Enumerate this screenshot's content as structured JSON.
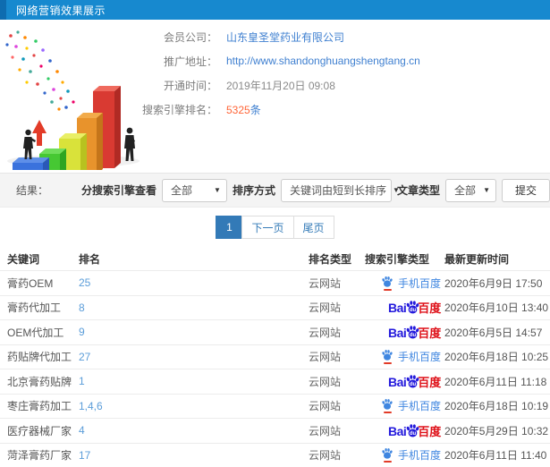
{
  "header": {
    "title": "网络营销效果展示"
  },
  "info": {
    "fields": [
      {
        "label": "会员公司：",
        "value": "山东皇圣堂药业有限公司"
      },
      {
        "label": "推广地址：",
        "value": "http://www.shandonghuangshengtang.cn"
      },
      {
        "label": "开通时间：",
        "value": "2019年11月20日 09:08"
      },
      {
        "label": "搜索引擎排名：",
        "value": "5325",
        "unit": "条"
      }
    ]
  },
  "filters": {
    "result_label": "结果：",
    "engine_filter_label": "分搜索引擎查看",
    "engine_filter_value": "全部",
    "sort_label": "排序方式",
    "sort_value": "关键词由短到长排序",
    "article_type_label": "文章类型",
    "article_type_value": "全部",
    "submit_label": "提交"
  },
  "pagination": {
    "current": "1",
    "next_label": "下一页",
    "last_label": "尾页"
  },
  "table": {
    "columns": [
      "关键词",
      "排名",
      "排名类型",
      "搜索引擎类型",
      "最新更新时间"
    ],
    "engine_labels": {
      "mobile": "手机百度",
      "baidu_bai": "Bai",
      "baidu_du": "du",
      "baidu_cn": "百度"
    },
    "rows": [
      {
        "keyword": "膏药OEM",
        "rank": "25",
        "rank_type": "云网站",
        "engine": "mobile-baidu",
        "updated": "2020年6月9日 17:50"
      },
      {
        "keyword": "膏药代加工",
        "rank": "8",
        "rank_type": "云网站",
        "engine": "baidu",
        "updated": "2020年6月10日 13:40"
      },
      {
        "keyword": "OEM代加工",
        "rank": "9",
        "rank_type": "云网站",
        "engine": "baidu",
        "updated": "2020年6月5日 14:57"
      },
      {
        "keyword": "药贴牌代加工",
        "rank": "27",
        "rank_type": "云网站",
        "engine": "mobile-baidu",
        "updated": "2020年6月18日 10:25"
      },
      {
        "keyword": "北京膏药贴牌",
        "rank": "1",
        "rank_type": "云网站",
        "engine": "baidu",
        "updated": "2020年6月11日 11:18"
      },
      {
        "keyword": "枣庄膏药加工",
        "rank": "1,4,6",
        "rank_type": "云网站",
        "engine": "mobile-baidu",
        "updated": "2020年6月18日 10:19"
      },
      {
        "keyword": "医疗器械厂家",
        "rank": "4",
        "rank_type": "云网站",
        "engine": "baidu",
        "updated": "2020年5月29日 10:32"
      },
      {
        "keyword": "菏泽膏药厂家",
        "rank": "17",
        "rank_type": "云网站",
        "engine": "mobile-baidu",
        "updated": "2020年6月11日 11:40"
      }
    ]
  },
  "colors": {
    "header_bg": "#1789cf",
    "accent_blue": "#337ab7",
    "link_blue": "#3e7fd0",
    "highlight_orange": "#ff6537",
    "baidu_blue": "#2319dc",
    "baidu_red": "#de0f17"
  }
}
